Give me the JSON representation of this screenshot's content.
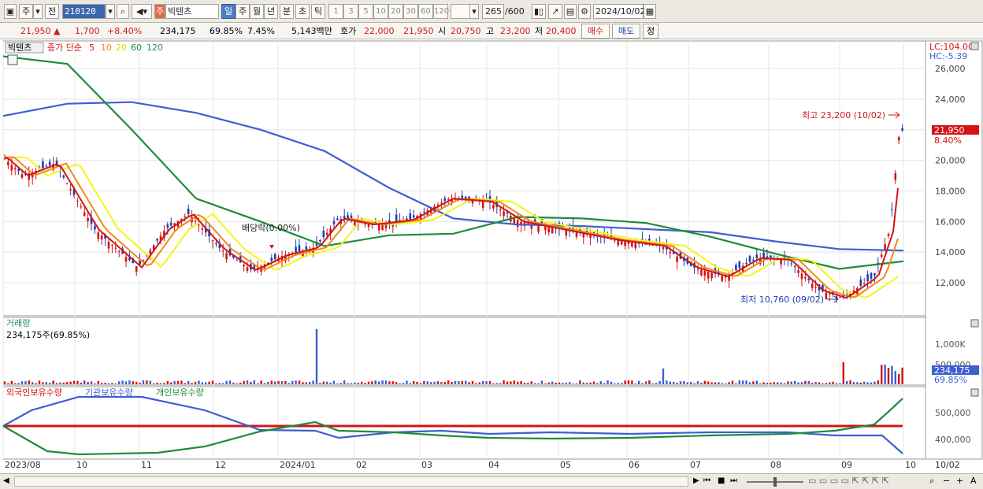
{
  "toolbar": {
    "period_select": "주",
    "prev_label": "전",
    "code": "210120",
    "name_tag": "주",
    "name": "빅텐츠",
    "periods": [
      "일",
      "주",
      "월",
      "년",
      "분",
      "초",
      "틱"
    ],
    "active_period": "일",
    "intervals": [
      "1",
      "3",
      "5",
      "10",
      "20",
      "30",
      "60",
      "120"
    ],
    "count": "265",
    "count_total": "/600",
    "date": "2024/10/02"
  },
  "quote": {
    "price": "21,950",
    "change": "1,700",
    "rate": "+8.40%",
    "volume": "234,175",
    "vol_ratio": "69.85%",
    "turnover": "7.45%",
    "amount": "5,143백만",
    "hoga_label": "호가",
    "hoga_ask": "22,000",
    "hoga_bid": "21,950",
    "open_label": "시",
    "open": "20,750",
    "high_label": "고",
    "high": "23,200",
    "low_label": "저",
    "low": "20,400",
    "buy_label": "매수",
    "sell_label": "매도",
    "extra_label": "정"
  },
  "price_panel": {
    "stock_tag": "빅텐츠",
    "ma_label": "종가 단순",
    "ma_periods": [
      "5",
      "10",
      "20",
      "60",
      "120"
    ],
    "ma_colors": {
      "5": "#d41414",
      "10": "#f08a18",
      "20": "#f5f518",
      "60": "#1e8c3a",
      "120": "#3c5fd2"
    },
    "lc": "LC:104.00",
    "hc": "HC:-5.39",
    "yticks": [
      "26,000",
      "24,000",
      "22,000",
      "20,000",
      "18,000",
      "16,000",
      "14,000",
      "12,000"
    ],
    "current_price": "21,950",
    "current_rate": "8.40%",
    "high_annot": "최고 23,200 (10/02)",
    "low_annot": "최저 10,760 (09/02)",
    "dividend_annot": "배당락(0.00%)"
  },
  "volume_panel": {
    "title": "거래량",
    "current": "234,175주(69.85%)",
    "yticks": [
      "1,000K",
      "500,000"
    ],
    "current_value": "234,175",
    "current_ratio": "69.85%"
  },
  "holding_panel": {
    "legend": [
      {
        "name": "외국인보유수량",
        "color": "#d41414"
      },
      {
        "name": "기관보유수량",
        "color": "#3c5fd2"
      },
      {
        "name": "개인보유수량",
        "color": "#1e8c3a"
      }
    ],
    "yticks": [
      "500,000",
      "400,000"
    ]
  },
  "xaxis": {
    "labels": [
      "2023/08",
      "10",
      "11",
      "12",
      "2024/01",
      "02",
      "03",
      "04",
      "05",
      "06",
      "07",
      "08",
      "09",
      "10"
    ],
    "right_label": "10/02"
  },
  "chart_data": {
    "type": "line",
    "title": "",
    "ylim": [
      10000,
      27000
    ],
    "x": [
      "2023/08",
      "09",
      "10",
      "11",
      "12",
      "2024/01",
      "02",
      "03",
      "04",
      "05",
      "06",
      "07",
      "08",
      "09",
      "10/02"
    ],
    "series": [
      {
        "name": "120",
        "values": [
          22900,
          23700,
          23800,
          23100,
          22000,
          20600,
          18200,
          16200,
          15800,
          15700,
          15500,
          15300,
          14700,
          14200,
          14100
        ]
      },
      {
        "name": "60",
        "values": [
          26800,
          26300,
          22000,
          17500,
          16000,
          14400,
          15100,
          15200,
          16300,
          16200,
          15900,
          15000,
          13900,
          12900,
          13400
        ]
      }
    ]
  }
}
